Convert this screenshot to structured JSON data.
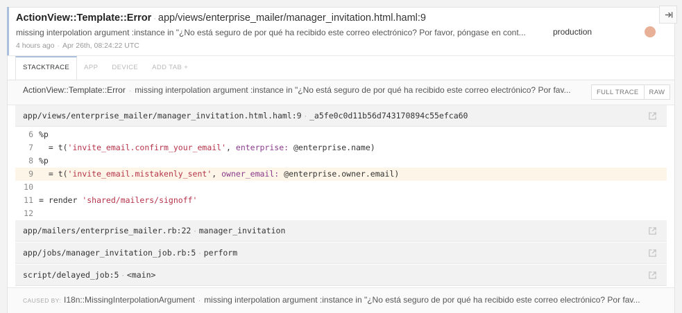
{
  "error": {
    "class": "ActionView::Template::Error",
    "file": "app/views/enterprise_mailer/manager_invitation.html.haml:9",
    "message": "missing interpolation argument :instance in \"¿No está seguro de por qué ha recibido este correo electrónico? Por favor, póngase en cont...",
    "environment": "production",
    "time_ago": "4 hours ago",
    "timestamp": "Apr 26th, 08:24:22 UTC",
    "close_icon": "arrow-right-bar-icon",
    "avatar_color": "#e8b096"
  },
  "tabs": [
    {
      "label": "STACKTRACE",
      "active": true
    },
    {
      "label": "APP",
      "active": false
    },
    {
      "label": "DEVICE",
      "active": false
    },
    {
      "label": "ADD TAB +",
      "active": false
    }
  ],
  "exception_row": {
    "class": "ActionView::Template::Error",
    "message": "missing interpolation argument :instance in \"¿No está seguro de por qué ha recibido este correo electrónico? Por fav...",
    "full_trace_label": "FULL TRACE",
    "raw_label": "RAW"
  },
  "frames": [
    {
      "file": "app/views/enterprise_mailer/manager_invitation.html.haml:9",
      "method": "_a5fe0c0d11b56d743170894c55efca60"
    },
    {
      "file": "app/mailers/enterprise_mailer.rb:22",
      "method": "manager_invitation"
    },
    {
      "file": "app/jobs/manager_invitation_job.rb:5",
      "method": "perform"
    },
    {
      "file": "script/delayed_job:5",
      "method": "<main>"
    }
  ],
  "code": [
    {
      "n": "6",
      "a": "%p",
      "s": "",
      "b": "",
      "k": "",
      "c": ""
    },
    {
      "n": "7",
      "a": "  = t(",
      "s": "'invite_email.confirm_your_email'",
      "b": ", ",
      "k": "enterprise:",
      "c": " @enterprise.name)"
    },
    {
      "n": "8",
      "a": "%p",
      "s": "",
      "b": "",
      "k": "",
      "c": ""
    },
    {
      "n": "9",
      "a": "  = t(",
      "s": "'invite_email.mistakenly_sent'",
      "b": ", ",
      "k": "owner_email:",
      "c": " @enterprise.owner.email)"
    },
    {
      "n": "10",
      "a": "",
      "s": "",
      "b": "",
      "k": "",
      "c": ""
    },
    {
      "n": "11",
      "a": "= render ",
      "s": "'shared/mailers/signoff'",
      "b": "",
      "k": "",
      "c": ""
    },
    {
      "n": "12",
      "a": "",
      "s": "",
      "b": "",
      "k": "",
      "c": ""
    }
  ],
  "highlight_line": "9",
  "caused_by": {
    "label": "CAUSED BY:",
    "class": "I18n::MissingInterpolationArgument",
    "message": "missing interpolation argument :instance in \"¿No está seguro de por qué ha recibido este correo electrónico? Por fav..."
  }
}
